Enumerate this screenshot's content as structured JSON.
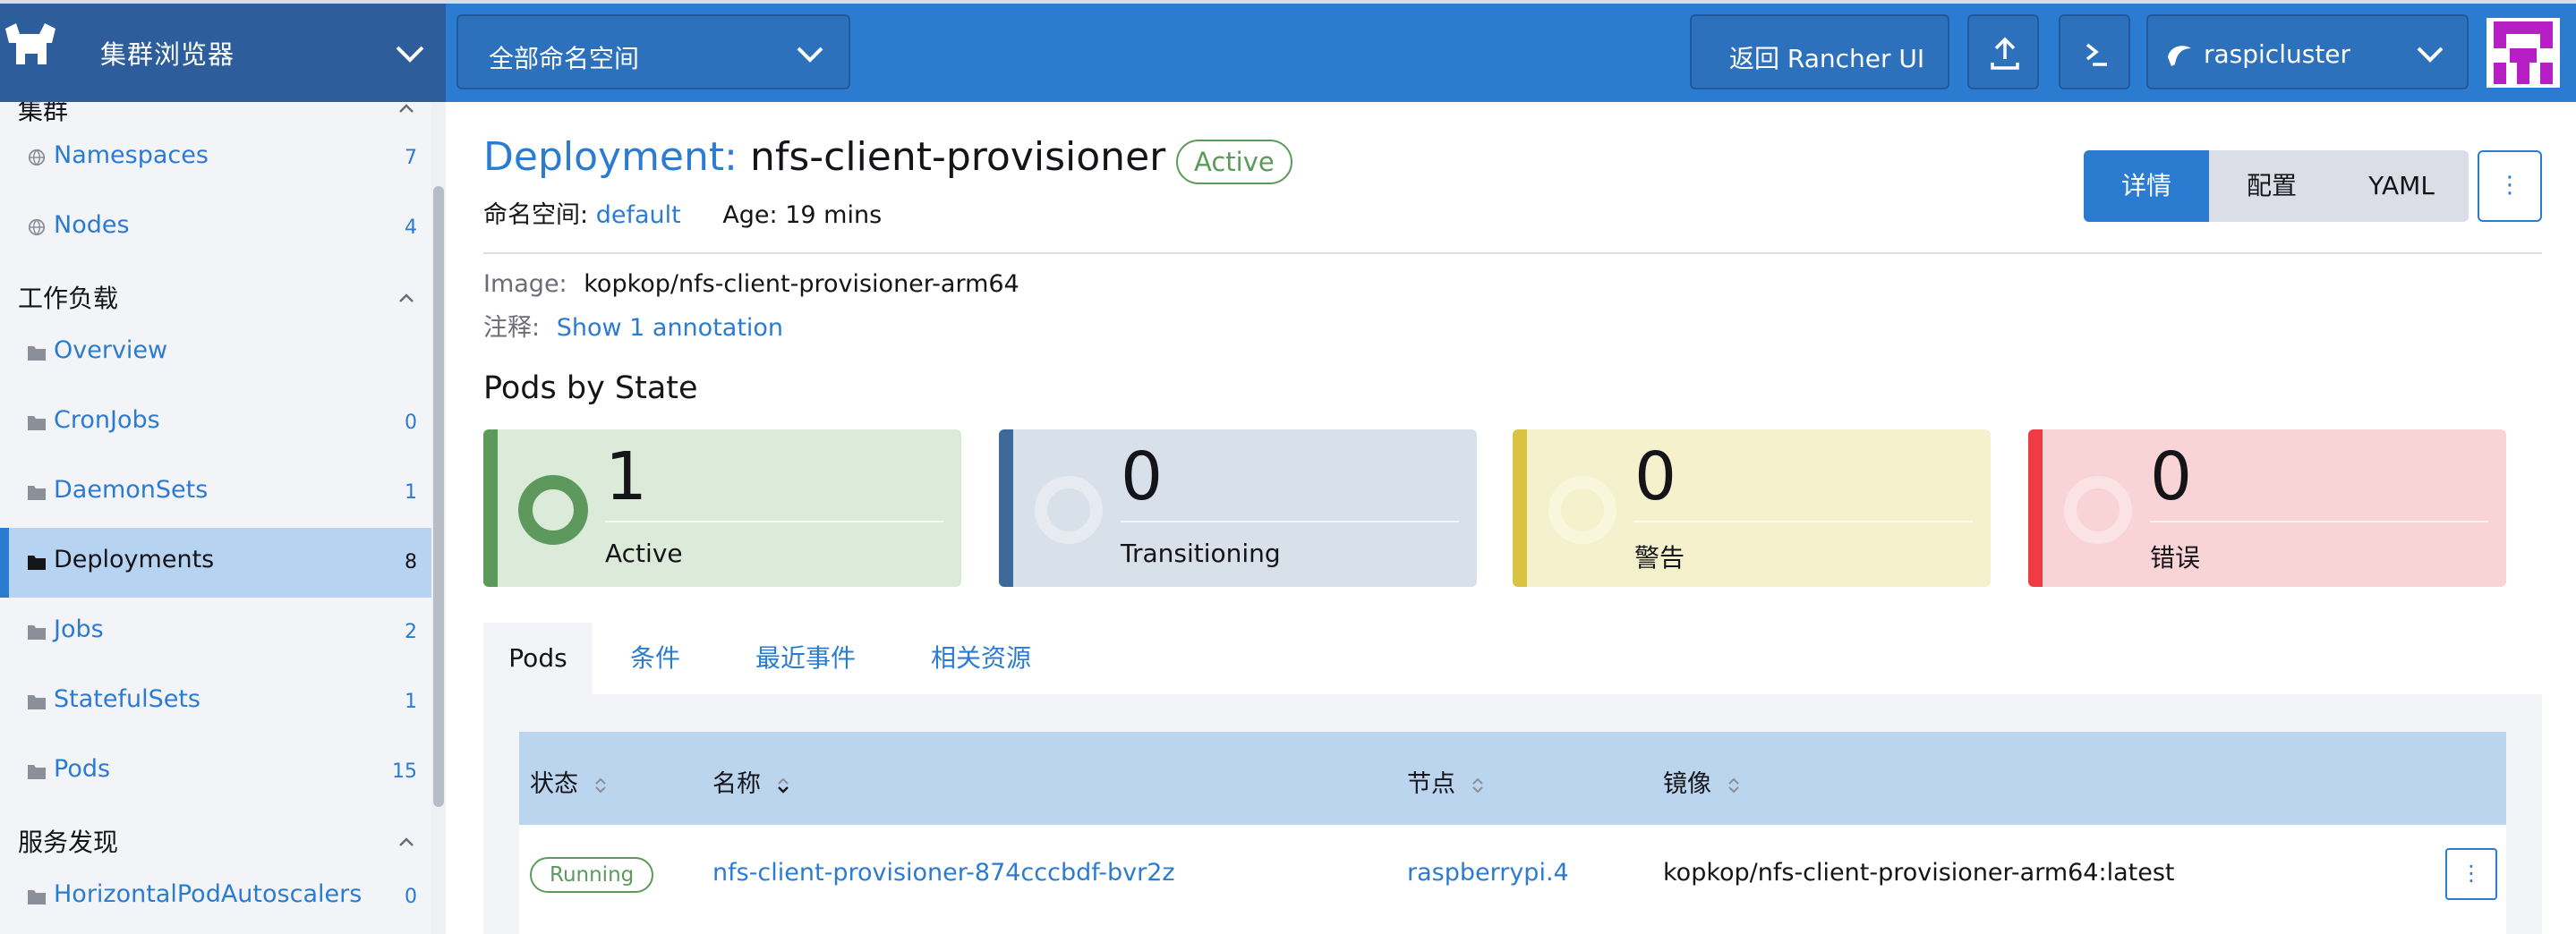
{
  "header": {
    "app_title": "集群浏览器",
    "namespace_select": "全部命名空间",
    "rancher_button": "返回 Rancher UI",
    "cluster_select": "raspicluster"
  },
  "sidebar": {
    "groups": [
      {
        "label": "集群"
      },
      {
        "label": "工作负载"
      },
      {
        "label": "服务发现"
      }
    ],
    "items": [
      {
        "label": "Namespaces",
        "count": "7",
        "icon": "globe-icon"
      },
      {
        "label": "Nodes",
        "count": "4",
        "icon": "globe-icon"
      },
      {
        "label": "Overview",
        "count": "",
        "icon": "folder-icon"
      },
      {
        "label": "CronJobs",
        "count": "0",
        "icon": "folder-icon"
      },
      {
        "label": "DaemonSets",
        "count": "1",
        "icon": "folder-icon"
      },
      {
        "label": "Deployments",
        "count": "8",
        "icon": "folder-icon"
      },
      {
        "label": "Jobs",
        "count": "2",
        "icon": "folder-icon"
      },
      {
        "label": "StatefulSets",
        "count": "1",
        "icon": "folder-icon"
      },
      {
        "label": "Pods",
        "count": "15",
        "icon": "folder-icon"
      },
      {
        "label": "HorizontalPodAutoscalers",
        "count": "0",
        "icon": "folder-icon"
      }
    ]
  },
  "detail": {
    "kind": "Deployment:",
    "name": "nfs-client-provisioner",
    "status": "Active",
    "namespace_label": "命名空间:",
    "namespace_value": "default",
    "age_label": "Age:",
    "age_value": "19 mins",
    "image_label": "Image:",
    "image_value": "kopkop/nfs-client-provisioner-arm64",
    "annotation_label": "注释:",
    "annotation_link": "Show 1 annotation",
    "view_tabs": [
      "详情",
      "配置",
      "YAML"
    ],
    "more": "⋮"
  },
  "pods_by_state": {
    "title": "Pods by State",
    "cards": [
      {
        "count": "1",
        "label": "Active"
      },
      {
        "count": "0",
        "label": "Transitioning"
      },
      {
        "count": "0",
        "label": "警告"
      },
      {
        "count": "0",
        "label": "错误"
      }
    ]
  },
  "tabs": [
    "Pods",
    "条件",
    "最近事件",
    "相关资源"
  ],
  "table": {
    "columns": [
      "状态",
      "名称",
      "节点",
      "镜像"
    ],
    "rows": [
      {
        "status": "Running",
        "name": "nfs-client-provisioner-874cccbdf-bvr2z",
        "node": "raspberrypi.4",
        "image": "kopkop/nfs-client-provisioner-arm64:latest",
        "more": "⋮"
      }
    ]
  },
  "colors": {
    "accent": "#2b7cd0",
    "header_bg": "#2b7cd0",
    "brand_bg": "#2d5e9b",
    "active_green": "#5d995d",
    "transition_blue": "#3d6a99",
    "warning_yellow": "#dac342",
    "error_red": "#f03b43"
  }
}
